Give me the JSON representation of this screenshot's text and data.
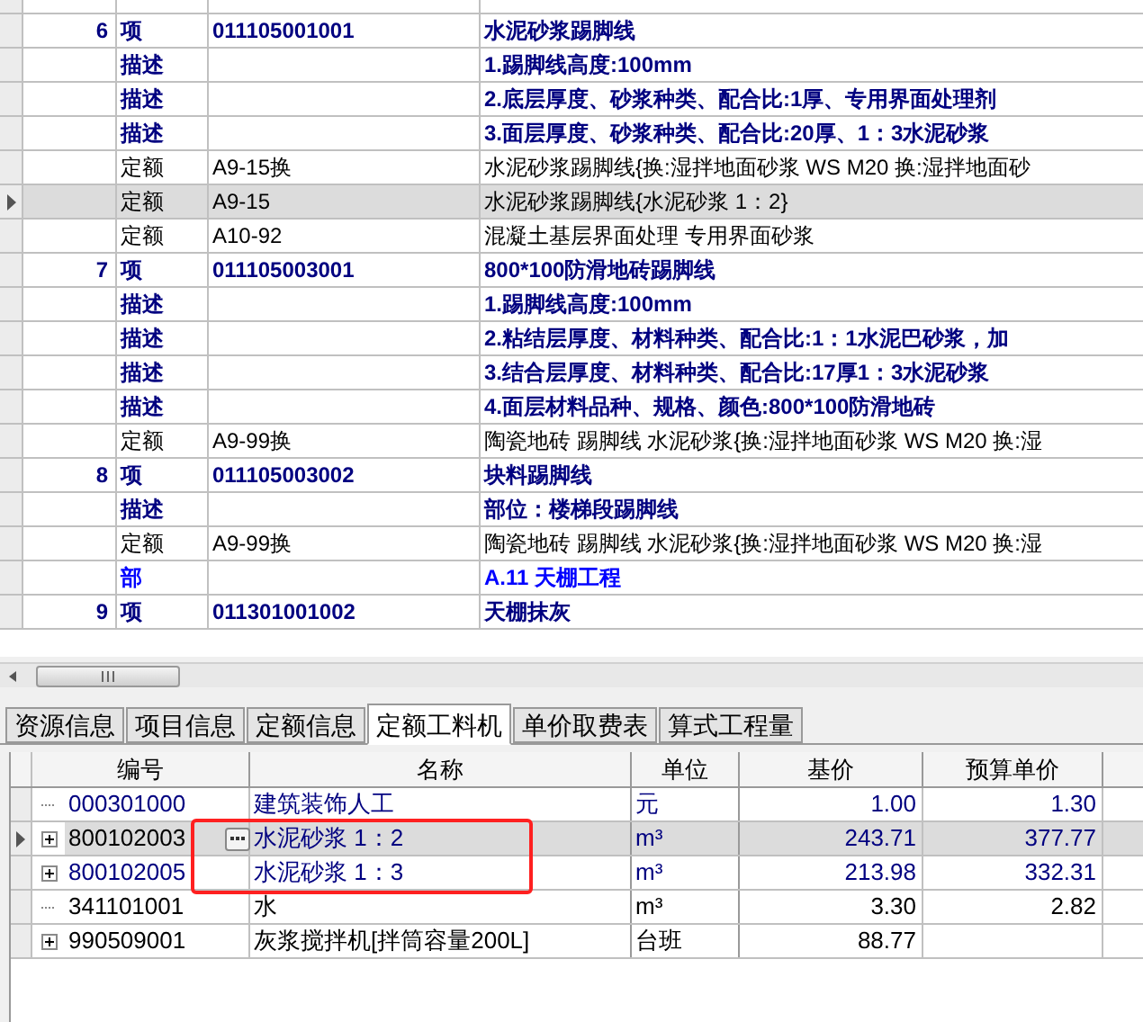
{
  "upper_grid": {
    "rows": [
      {
        "kind": "item",
        "number": "6",
        "type": "项",
        "code": "011105001001",
        "name": "水泥砂浆踢脚线",
        "selected": false
      },
      {
        "kind": "desc",
        "type": "描述",
        "name": "1.踢脚线高度:100mm",
        "selected": false
      },
      {
        "kind": "desc",
        "type": "描述",
        "name": "2.底层厚度、砂浆种类、配合比:1厚、专用界面处理剂",
        "selected": false
      },
      {
        "kind": "desc",
        "type": "描述",
        "name": "3.面层厚度、砂浆种类、配合比:20厚、1：3水泥砂浆",
        "selected": false
      },
      {
        "kind": "quota",
        "type": "定额",
        "code": "A9-15换",
        "name": "水泥砂浆踢脚线{换:湿拌地面砂浆 WS M20 换:湿拌地面砂",
        "selected": false
      },
      {
        "kind": "quota",
        "type": "定额",
        "code": "A9-15",
        "name": "水泥砂浆踢脚线{水泥砂浆 1：2}",
        "selected": true
      },
      {
        "kind": "quota",
        "type": "定额",
        "code": "A10-92",
        "name": "混凝土基层界面处理 专用界面砂浆",
        "selected": false
      },
      {
        "kind": "item",
        "number": "7",
        "type": "项",
        "code": "011105003001",
        "name": "800*100防滑地砖踢脚线",
        "selected": false
      },
      {
        "kind": "desc",
        "type": "描述",
        "name": "1.踢脚线高度:100mm",
        "selected": false
      },
      {
        "kind": "desc",
        "type": "描述",
        "name": "2.粘结层厚度、材料种类、配合比:1：1水泥巴砂浆，加",
        "selected": false
      },
      {
        "kind": "desc",
        "type": "描述",
        "name": "3.结合层厚度、材料种类、配合比:17厚1：3水泥砂浆",
        "selected": false
      },
      {
        "kind": "desc",
        "type": "描述",
        "name": "4.面层材料品种、规格、颜色:800*100防滑地砖",
        "selected": false
      },
      {
        "kind": "quota",
        "type": "定额",
        "code": "A9-99换",
        "name": "陶瓷地砖 踢脚线 水泥砂浆{换:湿拌地面砂浆 WS M20 换:湿",
        "selected": false
      },
      {
        "kind": "item",
        "number": "8",
        "type": "项",
        "code": "011105003002",
        "name": "块料踢脚线",
        "selected": false
      },
      {
        "kind": "desc",
        "type": "描述",
        "name": "部位：楼梯段踢脚线",
        "selected": false
      },
      {
        "kind": "quota",
        "type": "定额",
        "code": "A9-99换",
        "name": "陶瓷地砖 踢脚线 水泥砂浆{换:湿拌地面砂浆 WS M20 换:湿",
        "selected": false
      },
      {
        "kind": "section",
        "type": "部",
        "name": "A.11 天棚工程",
        "selected": false
      },
      {
        "kind": "item",
        "number": "9",
        "type": "项",
        "code": "011301001002",
        "name": "天棚抹灰",
        "selected": false
      }
    ]
  },
  "tabs": [
    {
      "label": "资源信息",
      "selected": false
    },
    {
      "label": "项目信息",
      "selected": false
    },
    {
      "label": "定额信息",
      "selected": false
    },
    {
      "label": "定额工料机",
      "selected": true
    },
    {
      "label": "单价取费表",
      "selected": false
    },
    {
      "label": "算式工程量",
      "selected": false
    }
  ],
  "lower_grid": {
    "columns": [
      "编号",
      "名称",
      "单位",
      "基价",
      "预算单价"
    ],
    "rows": [
      {
        "code": "000301000",
        "name": "建筑装饰人工",
        "unit": "元",
        "base_price": "1.00",
        "budget_price": "1.30",
        "color": "#000080",
        "expandable": false,
        "selected": false,
        "boxed": false
      },
      {
        "code": "800102003",
        "name": "水泥砂浆 1：2",
        "unit": "m³",
        "base_price": "243.71",
        "budget_price": "377.77",
        "color": "#000080",
        "expandable": true,
        "selected": true,
        "boxed": true
      },
      {
        "code": "800102005",
        "name": "水泥砂浆 1：3",
        "unit": "m³",
        "base_price": "213.98",
        "budget_price": "332.31",
        "color": "#000080",
        "expandable": true,
        "selected": false,
        "boxed": true
      },
      {
        "code": "341101001",
        "name": "水",
        "unit": "m³",
        "base_price": "3.30",
        "budget_price": "2.82",
        "color": "#000000",
        "expandable": false,
        "selected": false,
        "boxed": false
      },
      {
        "code": "990509001",
        "name": "灰浆搅拌机[拌筒容量200L]",
        "unit": "台班",
        "base_price": "88.77",
        "budget_price": "",
        "color": "#000000",
        "expandable": true,
        "selected": false,
        "boxed": false
      }
    ]
  }
}
